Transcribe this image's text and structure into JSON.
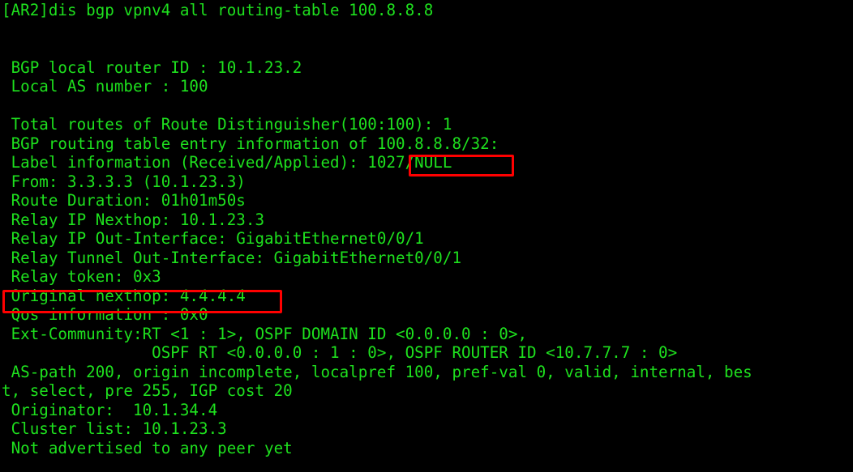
{
  "terminal": {
    "colors": {
      "background": "#000000",
      "text": "#1ee11e",
      "highlight_box": "#ff0000"
    },
    "prompt": "[AR2]",
    "command": "dis bgp vpnv4 all routing-table 100.8.8.8",
    "lines": [
      "[AR2]dis bgp vpnv4 all routing-table 100.8.8.8",
      "",
      "",
      " BGP local router ID : 10.1.23.2",
      " Local AS number : 100",
      "",
      " Total routes of Route Distinguisher(100:100): 1",
      " BGP routing table entry information of 100.8.8.8/32:",
      " Label information (Received/Applied): 1027/NULL",
      " From: 3.3.3.3 (10.1.23.3)",
      " Route Duration: 01h01m50s",
      " Relay IP Nexthop: 10.1.23.3",
      " Relay IP Out-Interface: GigabitEthernet0/0/1",
      " Relay Tunnel Out-Interface: GigabitEthernet0/0/1",
      " Relay token: 0x3",
      " Original nexthop: 4.4.4.4",
      " Qos information : 0x0",
      " Ext-Community:RT <1 : 1>, OSPF DOMAIN ID <0.0.0.0 : 0>,",
      "                OSPF RT <0.0.0.0 : 1 : 0>, OSPF ROUTER ID <10.7.7.7 : 0>",
      " AS-path 200, origin incomplete, localpref 100, pref-val 0, valid, internal, bes",
      "t, select, pre 255, IGP cost 20",
      " Originator:  10.1.34.4",
      " Cluster list: 10.1.23.3",
      " Not advertised to any peer yet"
    ],
    "fields": {
      "bgp_local_router_id": "10.1.23.2",
      "local_as_number": "100",
      "route_distinguisher": "100:100",
      "total_routes": "1",
      "prefix": "100.8.8.8/32",
      "label_information_received": "1027",
      "label_information_applied": "NULL",
      "from_router_id": "3.3.3.3",
      "from_address": "10.1.23.3",
      "route_duration": "01h01m50s",
      "relay_ip_nexthop": "10.1.23.3",
      "relay_ip_out_interface": "GigabitEthernet0/0/1",
      "relay_tunnel_out_interface": "GigabitEthernet0/0/1",
      "relay_token": "0x3",
      "original_nexthop": "4.4.4.4",
      "qos_information": "0x0",
      "ext_community_rt": "<1 : 1>",
      "ospf_domain_id": "<0.0.0.0 : 0>",
      "ospf_rt": "<0.0.0.0 : 1 : 0>",
      "ospf_router_id": "<10.7.7.7 : 0>",
      "as_path": "200",
      "origin": "incomplete",
      "localpref": "100",
      "pref_val": "0",
      "flags": "valid, internal, best, select",
      "pre": "255",
      "igp_cost": "20",
      "originator": "10.1.34.4",
      "cluster_list": "10.1.23.3",
      "advertisement_status": "Not advertised to any peer yet"
    },
    "annotations": [
      {
        "name": "label-information-value",
        "text": "1027/NULL"
      },
      {
        "name": "original-nexthop-line",
        "text": "Original nexthop: 4.4.4.4"
      }
    ]
  }
}
